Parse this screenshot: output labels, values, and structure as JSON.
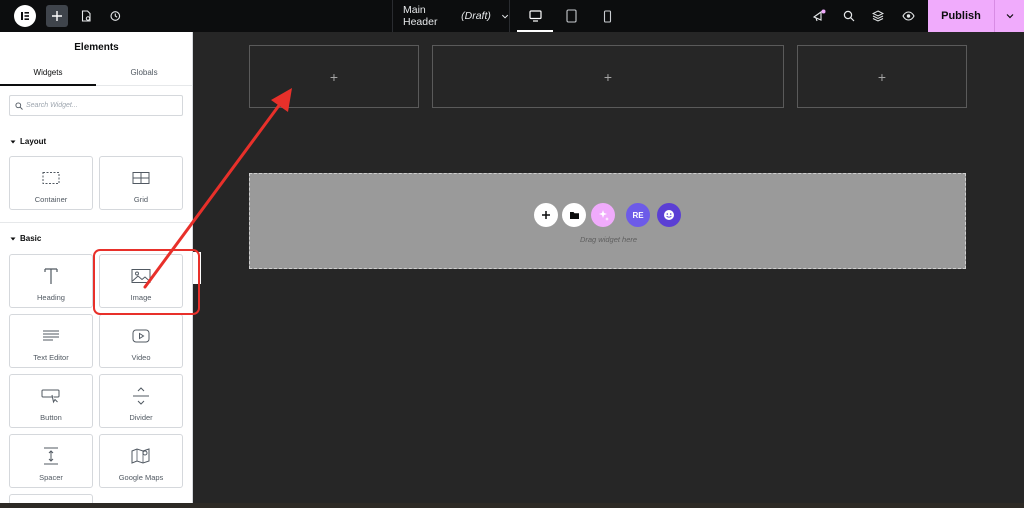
{
  "topbar": {
    "doc_title": "Main Header",
    "doc_status": "(Draft)",
    "publish_label": "Publish",
    "icons": [
      "elementor-logo-icon",
      "add-icon",
      "page-settings-icon",
      "history-icon",
      "chevron-down-icon",
      "desktop-icon",
      "tablet-icon",
      "mobile-icon",
      "announcements-icon",
      "search-icon",
      "structure-icon",
      "preview-icon"
    ]
  },
  "sidebar": {
    "title": "Elements",
    "tabs": [
      {
        "label": "Widgets",
        "active": true
      },
      {
        "label": "Globals",
        "active": false
      }
    ],
    "search_placeholder": "Search Widget...",
    "sections": [
      {
        "title": "Layout",
        "widgets": [
          {
            "label": "Container",
            "icon": "container-icon"
          },
          {
            "label": "Grid",
            "icon": "grid-icon"
          }
        ]
      },
      {
        "title": "Basic",
        "widgets": [
          {
            "label": "Heading",
            "icon": "heading-icon"
          },
          {
            "label": "Image",
            "icon": "image-icon"
          },
          {
            "label": "Text Editor",
            "icon": "text-editor-icon"
          },
          {
            "label": "Video",
            "icon": "video-icon"
          },
          {
            "label": "Button",
            "icon": "button-icon"
          },
          {
            "label": "Divider",
            "icon": "divider-icon"
          },
          {
            "label": "Spacer",
            "icon": "spacer-icon"
          },
          {
            "label": "Google Maps",
            "icon": "google-maps-icon"
          }
        ]
      }
    ]
  },
  "canvas": {
    "slot_label": "+",
    "dropzone_hint": "Drag widget here",
    "dropzone_buttons": [
      "add-section-icon",
      "template-library-icon",
      "ai-icon",
      "re-addon-icon",
      "smiley-addon-icon"
    ],
    "re_label": "RE"
  },
  "colors": {
    "topbar_bg": "#0c0d0e",
    "canvas_bg": "#262626",
    "publish_bg": "#f0abfc",
    "annotation_red": "#e8302a",
    "dropzone_bg": "#9a9a9a"
  }
}
